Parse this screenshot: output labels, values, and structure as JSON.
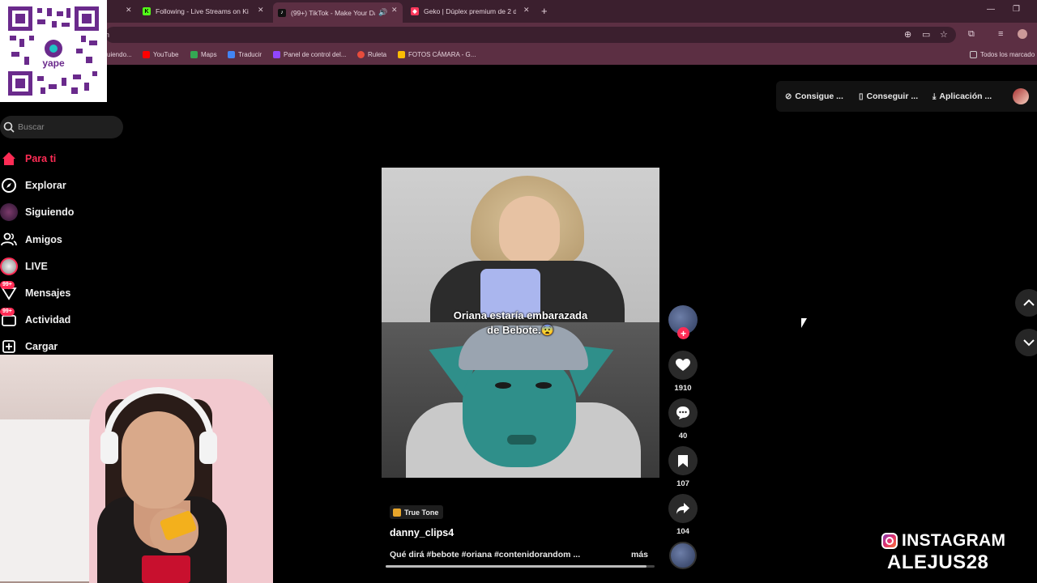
{
  "browser": {
    "tabs": [
      {
        "label": "Following - Live Streams on Ki",
        "icon": "kick-icon",
        "color": "#53fc18"
      },
      {
        "label": "(99+) TikTok - Make Your Da",
        "icon": "tiktok-icon",
        "color": "#000000",
        "active": true
      },
      {
        "label": "Geko | Dúplex premium de 2 d",
        "icon": "airbnb-icon",
        "color": "#ff385c"
      }
    ],
    "address_fragment": "n",
    "bookmarks": [
      {
        "label": "uiendo...",
        "icon": "bookmark-icon",
        "color": "#777777"
      },
      {
        "label": "YouTube",
        "icon": "youtube-icon",
        "color": "#ff0000"
      },
      {
        "label": "Maps",
        "icon": "maps-icon",
        "color": "#34a853"
      },
      {
        "label": "Traducir",
        "icon": "translate-icon",
        "color": "#4285f4"
      },
      {
        "label": "Panel de control del...",
        "icon": "twitch-icon",
        "color": "#9146ff"
      },
      {
        "label": "Ruleta",
        "icon": "wheel-icon",
        "color": "#e74c3c"
      },
      {
        "label": "FOTOS CÁMARA - G...",
        "icon": "drive-icon",
        "color": "#fbbc04"
      },
      {
        "label": "Todos los marcado",
        "icon": "folder-icon",
        "color": "#cccccc"
      }
    ]
  },
  "qr": {
    "brand": "yape"
  },
  "topbar": {
    "buttons": [
      {
        "label": "Consigue ...",
        "icon": "coin-icon"
      },
      {
        "label": "Conseguir ...",
        "icon": "phone-icon"
      },
      {
        "label": "Aplicación ...",
        "icon": "download-icon"
      }
    ]
  },
  "sidebar": {
    "search_placeholder": "Buscar",
    "items": [
      {
        "label": "Para ti",
        "icon": "home-icon",
        "active": true
      },
      {
        "label": "Explorar",
        "icon": "compass-icon"
      },
      {
        "label": "Siguiendo",
        "icon": "following-avatar-icon"
      },
      {
        "label": "Amigos",
        "icon": "friends-icon"
      },
      {
        "label": "LIVE",
        "icon": "live-icon"
      },
      {
        "label": "Mensajes",
        "icon": "messages-icon",
        "badge": "99+"
      },
      {
        "label": "Actividad",
        "icon": "activity-icon",
        "badge": "99+"
      },
      {
        "label": "Cargar",
        "icon": "upload-icon"
      }
    ]
  },
  "video": {
    "caption_line1": "Oriana estaría embarazada",
    "caption_line2": "de Bebote.😨",
    "sound_chip": "True Tone",
    "author": "danny_clips4",
    "description": "Qué dirá #bebote #oriana #contenidorandom ...",
    "more_label": "más",
    "progress": 0.97
  },
  "actions": {
    "likes": "1910",
    "comments": "40",
    "saves": "107",
    "shares": "104"
  },
  "watermark": {
    "platform": "INSTAGRAM",
    "handle": "ALEJUS28"
  }
}
